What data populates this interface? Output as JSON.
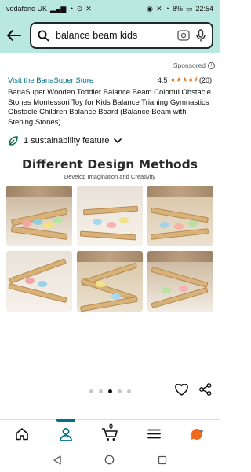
{
  "status_bar": {
    "carrier": "vodafone UK",
    "battery": "8%",
    "time": "22:54"
  },
  "search": {
    "query": "balance beam kids"
  },
  "sponsored": "Sponsored",
  "brand": {
    "link": "Visit the BanaSuper Store",
    "rating": "4.5",
    "stars": "★★★★⯨",
    "reviews": "(20)"
  },
  "product_title": "BanaSuper Wooden Toddler Balance Beam Colorful Obstacle Stones Montessori Toy for Kids Balance Trianing Gymnastics Obstacle Children Balance Board (Balance Beam with Steping Stones)",
  "sustainability": {
    "label": "1 sustainability feature"
  },
  "image": {
    "heading": "Different Design Methods",
    "subheading": "Develop Imagination and Creativity"
  },
  "carousel": {
    "count": 5,
    "active_index": 2
  },
  "bottom_nav": {
    "cart_count": "0",
    "active": "account"
  },
  "colors": {
    "accent": "#007185",
    "header_bg": "#b9e8e0",
    "star": "#de7921"
  },
  "icons": [
    "back-arrow-icon",
    "search-icon",
    "camera-icon",
    "mic-icon",
    "leaf-icon",
    "chevron-down-icon",
    "heart-icon",
    "share-icon",
    "home-icon",
    "account-icon",
    "cart-icon",
    "menu-icon",
    "ai-assistant-icon"
  ]
}
